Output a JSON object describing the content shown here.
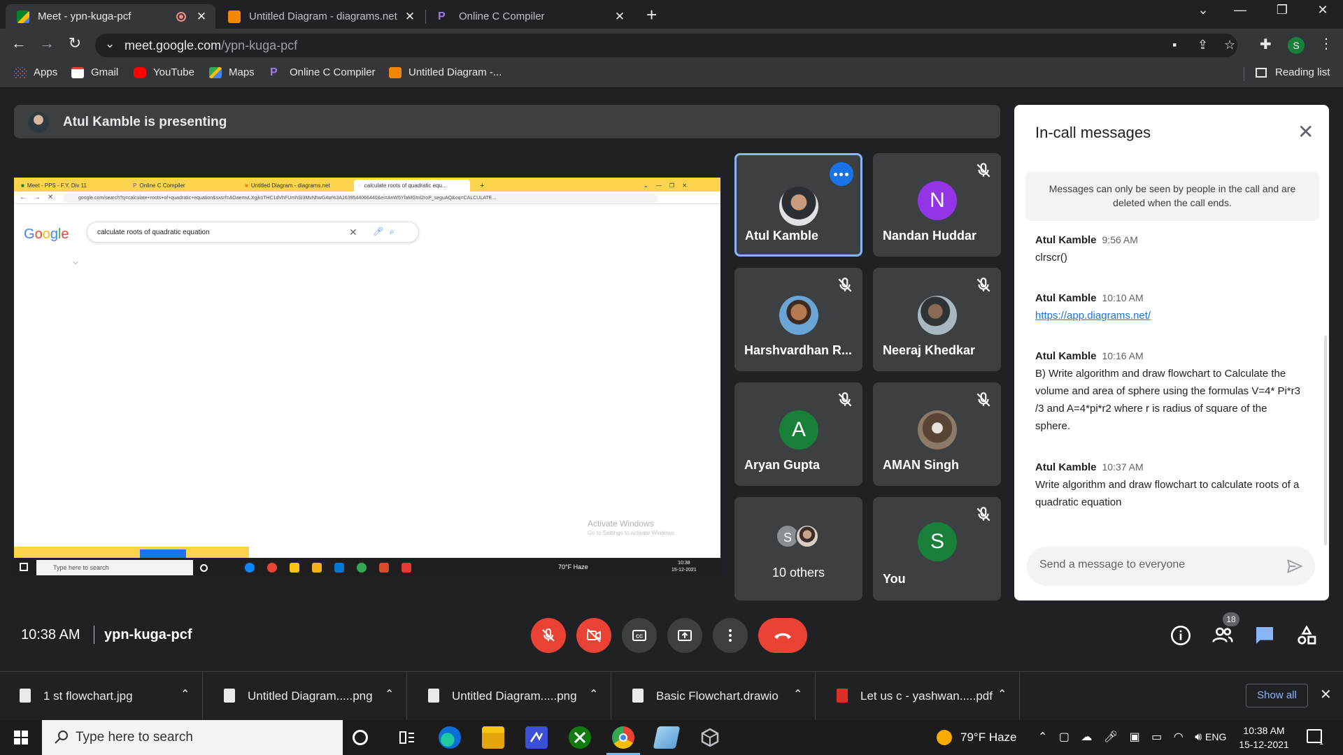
{
  "browser": {
    "tabs": [
      {
        "title": "Meet - ypn-kuga-pcf",
        "active": true,
        "favicon_color": "#00832d"
      },
      {
        "title": "Untitled Diagram - diagrams.net",
        "active": false,
        "favicon_color": "#f08705"
      },
      {
        "title": "Online C Compiler",
        "active": false,
        "favicon_color": "#7b3fe4"
      }
    ],
    "address": {
      "host": "meet.google.com",
      "path": "/ypn-kuga-pcf"
    },
    "profile_initial": "S",
    "bookmarks": [
      {
        "label": "Apps",
        "icon_color": "#4285f4"
      },
      {
        "label": "Gmail",
        "icon_color": "#ea4335"
      },
      {
        "label": "YouTube",
        "icon_color": "#ff0000"
      },
      {
        "label": "Maps",
        "icon_color": "#34a853"
      },
      {
        "label": "Online C Compiler",
        "icon_color": "#7b3fe4"
      },
      {
        "label": "Untitled Diagram -...",
        "icon_color": "#f08705"
      }
    ],
    "reading_list": "Reading list"
  },
  "meet": {
    "presenting": "Atul Kamble is presenting",
    "shared_screen": {
      "tabs": [
        "Meet - PPS - F.Y. Div 11",
        "Online C Compiler",
        "Untitled Diagram - diagrams.net",
        "calculate roots of quadratic equ..."
      ],
      "url": "google.com/search?q=calculate+roots+of+quadratic+equation&sxsrf=AOaemvLXgjkoTHC1dVhFUmhSI3MvNhwG4w%3A1639544066440&ei=AnW5YfaMGtnl2roP_seguAQ&oq=CALCULATE...",
      "logo": "Google",
      "query": "calculate roots of quadratic equation",
      "activate_windows": "Activate Windows",
      "activate_windows_sub": "Go to Settings to activate Windows.",
      "taskbar_search": "Type here to search",
      "tray": "70°F  Haze",
      "clock_time": "10:38",
      "clock_date": "15-12-2021"
    },
    "participants": [
      {
        "name": "Atul Kamble",
        "initial": "",
        "color": "#5f6368",
        "muted": false,
        "speaking": true
      },
      {
        "name": "Nandan Huddar",
        "initial": "N",
        "color": "#9334e6",
        "muted": true,
        "speaking": false
      },
      {
        "name": "Harshvardhan R...",
        "initial": "",
        "color": "#c17a4a",
        "muted": true,
        "speaking": false
      },
      {
        "name": "Neeraj Khedkar",
        "initial": "",
        "color": "#6d7b82",
        "muted": true,
        "speaking": false
      },
      {
        "name": "Aryan Gupta",
        "initial": "A",
        "color": "#188038",
        "muted": true,
        "speaking": false
      },
      {
        "name": "AMAN Singh",
        "initial": "",
        "color": "#6b5a4e",
        "muted": true,
        "speaking": false
      },
      {
        "name": "10 others",
        "initial": "S",
        "color": "#5f6368",
        "muted": false,
        "speaking": false
      },
      {
        "name": "You",
        "initial": "S",
        "color": "#188038",
        "muted": true,
        "speaking": false
      }
    ],
    "time": "10:38 AM",
    "meeting_code": "ypn-kuga-pcf",
    "people_count": "18"
  },
  "chat": {
    "title": "In-call messages",
    "notice": "Messages can only be seen by people in the call and are deleted when the call ends.",
    "messages": [
      {
        "sender": "Atul Kamble",
        "time": "9:56 AM",
        "text": "clrscr()"
      },
      {
        "sender": "Atul Kamble",
        "time": "10:10 AM",
        "text": "https://app.diagrams.net/"
      },
      {
        "sender": "Atul Kamble",
        "time": "10:16 AM",
        "text": "B) Write algorithm and draw flowchart to Calculate the volume and area of sphere using the formulas V=4* Pi*r3 /3 and A=4*pi*r2 where r is radius of square of the sphere."
      },
      {
        "sender": "Atul Kamble",
        "time": "10:37 AM",
        "text": "Write algorithm and draw flowchart to calculate roots of a quadratic equation"
      }
    ],
    "input_placeholder": "Send a message to everyone"
  },
  "downloads": {
    "items": [
      {
        "name": "1 st flowchart.jpg",
        "type": "image"
      },
      {
        "name": "Untitled Diagram.....png",
        "type": "image"
      },
      {
        "name": "Untitled Diagram.....png",
        "type": "image"
      },
      {
        "name": "Basic Flowchart.drawio",
        "type": "file"
      },
      {
        "name": "Let us c - yashwan.....pdf",
        "type": "pdf"
      }
    ],
    "show_all": "Show all"
  },
  "taskbar": {
    "search_placeholder": "Type here to search",
    "weather": "79°F  Haze",
    "language": "ENG",
    "time": "10:38 AM",
    "date": "15-12-2021",
    "notifications": "1"
  }
}
